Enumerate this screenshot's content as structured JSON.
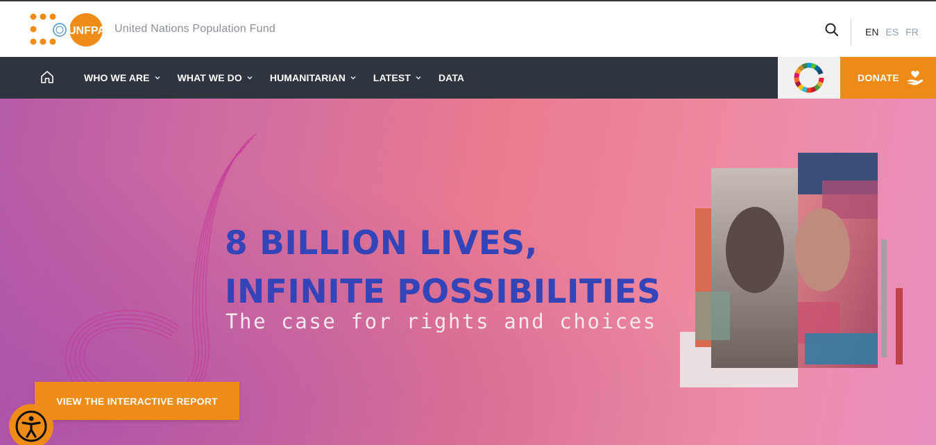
{
  "header": {
    "logo_text": "UNFPA",
    "org_name": "United Nations Population Fund",
    "search_icon": "search-icon",
    "languages": [
      "EN",
      "ES",
      "FR"
    ],
    "active_language": "EN"
  },
  "nav": {
    "home_icon": "home-icon",
    "items": [
      {
        "label": "WHO WE ARE"
      },
      {
        "label": "WHAT WE DO"
      },
      {
        "label": "HUMANITARIAN"
      },
      {
        "label": "LATEST"
      },
      {
        "label": "DATA"
      }
    ],
    "donate_label": "DONATE"
  },
  "hero": {
    "headline_line1": "8 BILLION LIVES,",
    "headline_line2": "INFINITE POSSIBILITIES",
    "subline": "The case for rights and choices",
    "cta_label": "VIEW THE INTERACTIVE REPORT"
  },
  "colors": {
    "brand_orange": "#ef8c17",
    "nav_bg": "#2f353f",
    "headline_blue": "#3343b8"
  }
}
